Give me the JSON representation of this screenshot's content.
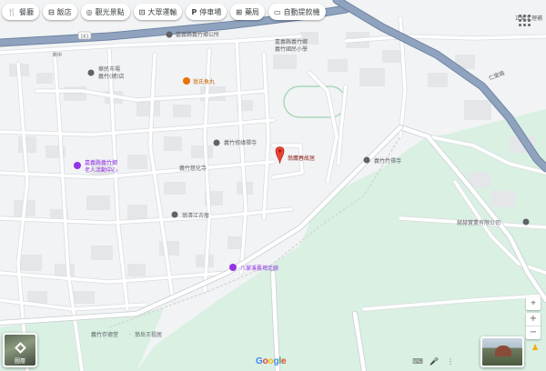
{
  "map": {
    "colors": {
      "land": "#f1f3f4",
      "park": "#d9f0e3",
      "road": "#ffffff",
      "road_casing": "#d9dce0",
      "highway": "#8fa3bf",
      "highway_casing": "#6f84a3",
      "building": "#e4e6e9",
      "poi_purple": "#9334e6",
      "poi_gray": "#5f6368",
      "poi_orange": "#e8710a",
      "pin_red": "#ea4335"
    },
    "labels": {
      "route": "161",
      "west_road": "新中",
      "east_road": "仁愛路",
      "gov_office": "嘉義縣義竹鄉公所",
      "school_line1": "嘉義縣義竹鄉",
      "school_line2": "義竹國民小學",
      "shop_line1": "華民市場",
      "shop_line2": "義竹(總)店",
      "east_label": "正德文理補",
      "restaurant": "翁氏魚丸",
      "temple1": "義竹修緣禪寺",
      "home": "翁鷹春故居",
      "temple2": "義竹竹禪寺",
      "senior_line1": "嘉義縣義竹鄉",
      "senior_line2": "老人活動中心",
      "temple3": "義竹慈化寺",
      "shrine": "翁清江古厝",
      "company": "赫赫實業有限公司",
      "corridor": "八掌溪舊埤走廊",
      "bottom_left": "義竹存德堂",
      "bottom_right": "翁岳王祖居"
    }
  },
  "chips": [
    {
      "icon": "fork-knife-icon",
      "glyph": "🍴",
      "label": "餐廳"
    },
    {
      "icon": "bed-icon",
      "glyph": "⊟",
      "label": "飯店"
    },
    {
      "icon": "camera-icon",
      "glyph": "◎",
      "label": "觀光景點"
    },
    {
      "icon": "bus-icon",
      "glyph": "⊡",
      "label": "大眾運輸"
    },
    {
      "icon": "parking-icon",
      "glyph": "P",
      "label": "停車場"
    },
    {
      "icon": "pharmacy-icon",
      "glyph": "⊞",
      "label": "藥局"
    },
    {
      "icon": "atm-icon",
      "glyph": "▭",
      "label": "自動提款機"
    }
  ],
  "controls": {
    "layers_label": "圖層",
    "brand_letters": [
      "G",
      "o",
      "o",
      "g",
      "l",
      "e"
    ],
    "zoom_in": "+",
    "zoom_out": "−",
    "locate": "⌖",
    "pegman": "♟"
  }
}
